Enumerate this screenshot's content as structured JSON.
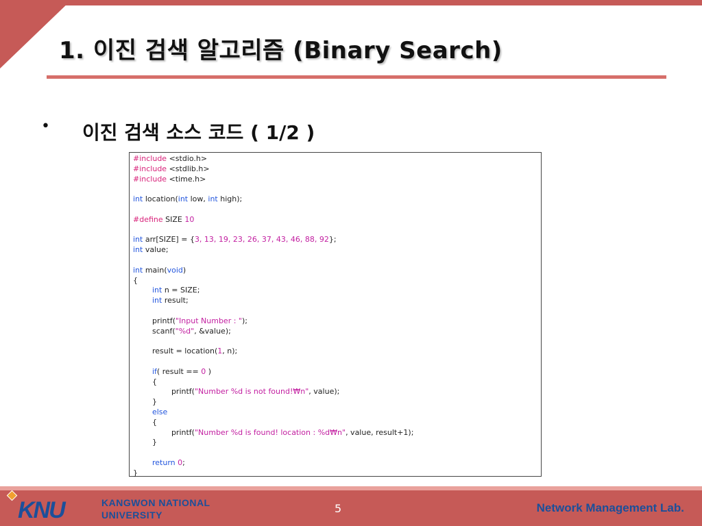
{
  "slide": {
    "title": "1. 이진 검색 알고리즘 (Binary Search)",
    "bullet_symbol": "•",
    "bullet_text": "이진 검색 소스 코드 ( 1/2 )",
    "page_number": "5"
  },
  "code": {
    "lines": [
      [
        {
          "t": "#include",
          "c": "pp"
        },
        {
          "t": " <stdio.h>",
          "c": "txt"
        }
      ],
      [
        {
          "t": "#include",
          "c": "pp"
        },
        {
          "t": " <stdlib.h>",
          "c": "txt"
        }
      ],
      [
        {
          "t": "#include",
          "c": "pp"
        },
        {
          "t": " <time.h>",
          "c": "txt"
        }
      ],
      [],
      [
        {
          "t": "int",
          "c": "kw"
        },
        {
          "t": " location(",
          "c": "txt"
        },
        {
          "t": "int",
          "c": "kw"
        },
        {
          "t": " low, ",
          "c": "txt"
        },
        {
          "t": "int",
          "c": "kw"
        },
        {
          "t": " high);",
          "c": "txt"
        }
      ],
      [],
      [
        {
          "t": "#define",
          "c": "pp"
        },
        {
          "t": " SIZE ",
          "c": "txt"
        },
        {
          "t": "10",
          "c": "num"
        }
      ],
      [],
      [
        {
          "t": "int",
          "c": "kw"
        },
        {
          "t": " arr[SIZE] = {",
          "c": "txt"
        },
        {
          "t": "3, 13, 19, 23, 26, 37, 43, 46, 88, 92",
          "c": "num"
        },
        {
          "t": "};",
          "c": "txt"
        }
      ],
      [
        {
          "t": "int",
          "c": "kw"
        },
        {
          "t": " value;",
          "c": "txt"
        }
      ],
      [],
      [
        {
          "t": "int",
          "c": "kw"
        },
        {
          "t": " main(",
          "c": "txt"
        },
        {
          "t": "void",
          "c": "kw"
        },
        {
          "t": ")",
          "c": "txt"
        }
      ],
      [
        {
          "t": "{",
          "c": "txt"
        }
      ],
      [
        {
          "t": "        ",
          "c": "txt"
        },
        {
          "t": "int",
          "c": "kw"
        },
        {
          "t": " n = SIZE;",
          "c": "txt"
        }
      ],
      [
        {
          "t": "        ",
          "c": "txt"
        },
        {
          "t": "int",
          "c": "kw"
        },
        {
          "t": " result;",
          "c": "txt"
        }
      ],
      [],
      [
        {
          "t": "        printf(",
          "c": "txt"
        },
        {
          "t": "\"Input Number : \"",
          "c": "str"
        },
        {
          "t": ");",
          "c": "txt"
        }
      ],
      [
        {
          "t": "        scanf(",
          "c": "txt"
        },
        {
          "t": "\"%d\"",
          "c": "str"
        },
        {
          "t": ", &value);",
          "c": "txt"
        }
      ],
      [],
      [
        {
          "t": "        result = location(",
          "c": "txt"
        },
        {
          "t": "1",
          "c": "num"
        },
        {
          "t": ", n);",
          "c": "txt"
        }
      ],
      [],
      [
        {
          "t": "        ",
          "c": "txt"
        },
        {
          "t": "if",
          "c": "kw"
        },
        {
          "t": "( result == ",
          "c": "txt"
        },
        {
          "t": "0",
          "c": "num"
        },
        {
          "t": " )",
          "c": "txt"
        }
      ],
      [
        {
          "t": "        {",
          "c": "txt"
        }
      ],
      [
        {
          "t": "                printf(",
          "c": "txt"
        },
        {
          "t": "\"Number %d is not found!₩n\"",
          "c": "str"
        },
        {
          "t": ", value);",
          "c": "txt"
        }
      ],
      [
        {
          "t": "        }",
          "c": "txt"
        }
      ],
      [
        {
          "t": "        ",
          "c": "txt"
        },
        {
          "t": "else",
          "c": "kw"
        }
      ],
      [
        {
          "t": "        {",
          "c": "txt"
        }
      ],
      [
        {
          "t": "                printf(",
          "c": "txt"
        },
        {
          "t": "\"Number %d is found! location : %d₩n\"",
          "c": "str"
        },
        {
          "t": ", value, result+1);",
          "c": "txt"
        }
      ],
      [
        {
          "t": "        }",
          "c": "txt"
        }
      ],
      [],
      [
        {
          "t": "        ",
          "c": "txt"
        },
        {
          "t": "return",
          "c": "kw"
        },
        {
          "t": " ",
          "c": "txt"
        },
        {
          "t": "0",
          "c": "num"
        },
        {
          "t": ";",
          "c": "txt"
        }
      ],
      [
        {
          "t": "}",
          "c": "txt"
        }
      ]
    ]
  },
  "footer": {
    "logo_text": "KNU",
    "university_line1": "KANGWON NATIONAL",
    "university_line2": "UNIVERSITY",
    "lab_name": "Network Management Lab."
  },
  "colors": {
    "accent": "#c65a57",
    "title_rule": "#d66f6a",
    "brand_blue": "#1b4f9a",
    "keyword": "#2255dd",
    "preprocessor": "#d8227a",
    "string": "#c21ea0"
  }
}
